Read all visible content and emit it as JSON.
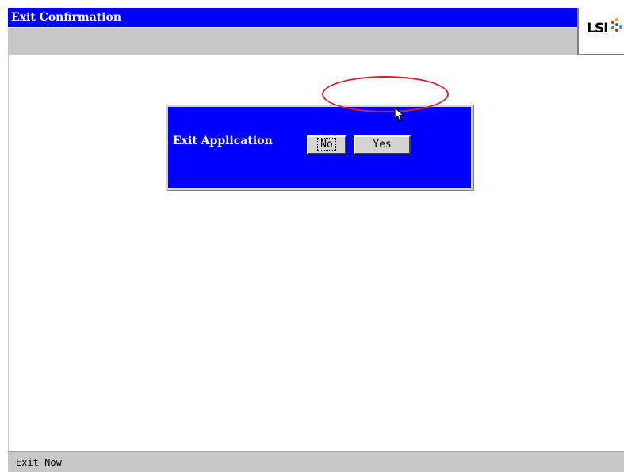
{
  "window": {
    "title": "Exit Confirmation"
  },
  "logo": {
    "text": "LSI"
  },
  "dialog": {
    "label": "Exit Application",
    "buttons": {
      "no_label": "No",
      "yes_label": "Yes"
    }
  },
  "status_bar": {
    "text": "Exit Now"
  },
  "colors": {
    "title_bar": "#0000ff",
    "dialog_background": "#0000ff",
    "highlight_circle": "#d8202a",
    "chrome_gray": "#c8c8c8"
  },
  "icons": {
    "cursor": "mouse-pointer-icon",
    "logo_mark": "lsi-logo-mark-icon"
  }
}
